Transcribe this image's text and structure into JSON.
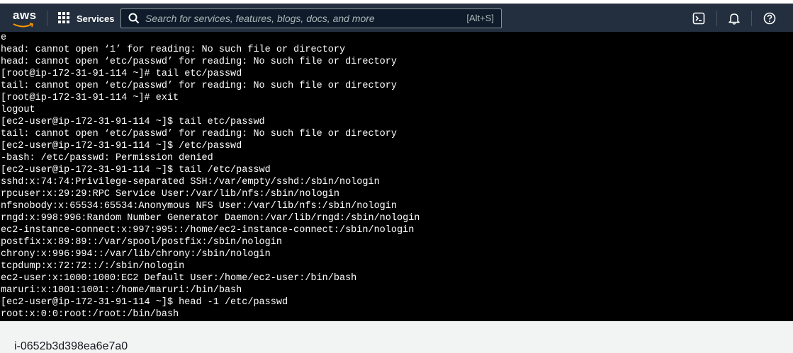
{
  "header": {
    "logo_text": "aws",
    "services_label": "Services",
    "search_placeholder": "Search for services, features, blogs, docs, and more",
    "search_shortcut": "[Alt+S]"
  },
  "terminal": {
    "lines": [
      "e",
      "head: cannot open ‘1’ for reading: No such file or directory",
      "head: cannot open ‘etc/passwd’ for reading: No such file or directory",
      "[root@ip-172-31-91-114 ~]# tail etc/passwd",
      "tail: cannot open ‘etc/passwd’ for reading: No such file or directory",
      "[root@ip-172-31-91-114 ~]# exit",
      "logout",
      "[ec2-user@ip-172-31-91-114 ~]$ tail etc/passwd",
      "tail: cannot open ‘etc/passwd’ for reading: No such file or directory",
      "[ec2-user@ip-172-31-91-114 ~]$ /etc/passwd",
      "-bash: /etc/passwd: Permission denied",
      "[ec2-user@ip-172-31-91-114 ~]$ tail /etc/passwd",
      "sshd:x:74:74:Privilege-separated SSH:/var/empty/sshd:/sbin/nologin",
      "rpcuser:x:29:29:RPC Service User:/var/lib/nfs:/sbin/nologin",
      "nfsnobody:x:65534:65534:Anonymous NFS User:/var/lib/nfs:/sbin/nologin",
      "rngd:x:998:996:Random Number Generator Daemon:/var/lib/rngd:/sbin/nologin",
      "ec2-instance-connect:x:997:995::/home/ec2-instance-connect:/sbin/nologin",
      "postfix:x:89:89::/var/spool/postfix:/sbin/nologin",
      "chrony:x:996:994::/var/lib/chrony:/sbin/nologin",
      "tcpdump:x:72:72::/:/sbin/nologin",
      "ec2-user:x:1000:1000:EC2 Default User:/home/ec2-user:/bin/bash",
      "maruri:x:1001:1001::/home/maruri:/bin/bash",
      "[ec2-user@ip-172-31-91-114 ~]$ head -1 /etc/passwd",
      "root:x:0:0:root:/root:/bin/bash"
    ]
  },
  "footer": {
    "instance_id": "i-0652b3d398ea6e7a0"
  },
  "colors": {
    "topbar": "#232f3e",
    "terminal_bg": "#000000",
    "terminal_fg": "#ffffff",
    "page_bg": "#f2f3f3"
  },
  "icons": [
    "aws-logo",
    "services-grid-icon",
    "search-icon",
    "cloudshell-icon",
    "bell-icon",
    "help-icon"
  ]
}
